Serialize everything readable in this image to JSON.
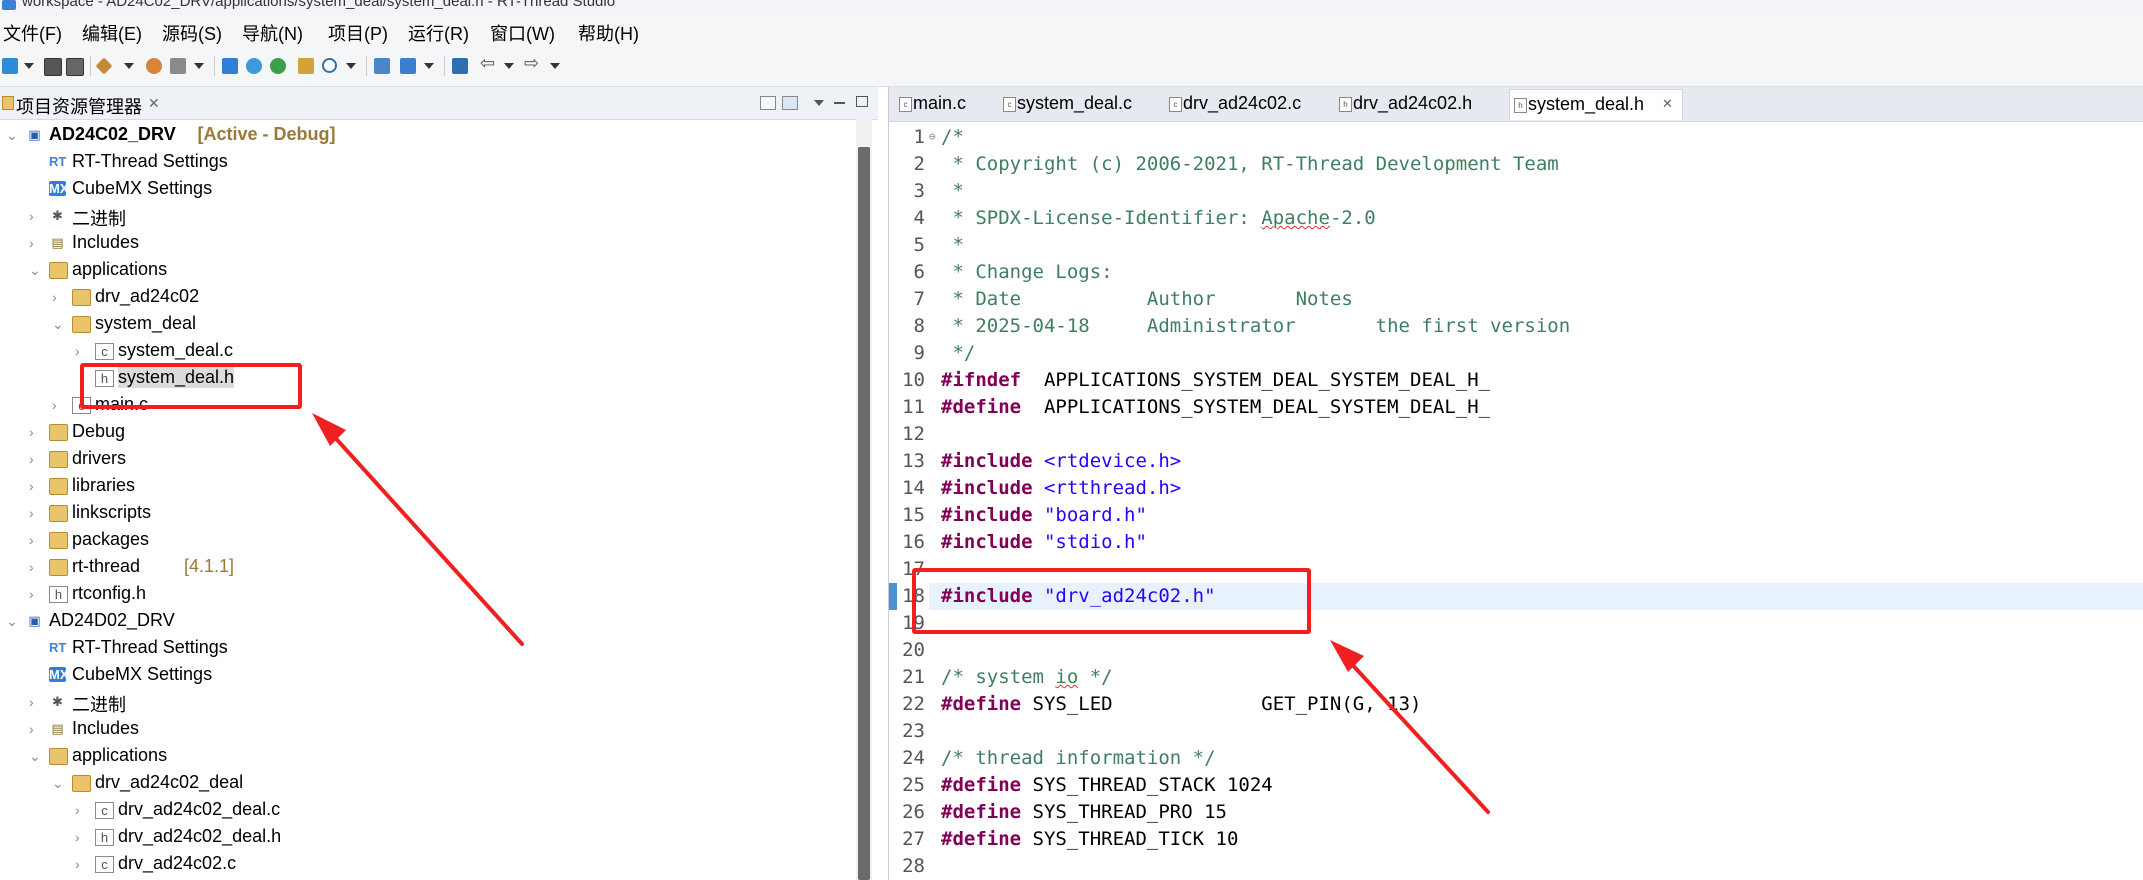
{
  "window": {
    "title": "workspace - AD24C02_DRV/applications/system_deal/system_deal.h - RT-Thread Studio"
  },
  "menu": [
    "文件(F)",
    "编辑(E)",
    "源码(S)",
    "导航(N)",
    "项目(P)",
    "运行(R)",
    "窗口(W)",
    "帮助(H)"
  ],
  "explorer": {
    "title": "项目资源管理器",
    "tree": [
      {
        "level": 0,
        "twisty": "open",
        "icon": "project",
        "label": "AD24C02_DRV",
        "suffix": "[Active - Debug]",
        "bold": true
      },
      {
        "level": 1,
        "twisty": "",
        "icon": "rt",
        "label": "RT-Thread Settings"
      },
      {
        "level": 1,
        "twisty": "",
        "icon": "mx",
        "label": "CubeMX Settings"
      },
      {
        "level": 1,
        "twisty": "closed",
        "icon": "binary",
        "label": "二进制"
      },
      {
        "level": 1,
        "twisty": "closed",
        "icon": "includes",
        "label": "Includes"
      },
      {
        "level": 1,
        "twisty": "open",
        "icon": "folder",
        "label": "applications"
      },
      {
        "level": 2,
        "twisty": "closed",
        "icon": "folder",
        "label": "drv_ad24c02"
      },
      {
        "level": 2,
        "twisty": "open",
        "icon": "folder",
        "label": "system_deal"
      },
      {
        "level": 3,
        "twisty": "closed",
        "icon": "c",
        "label": "system_deal.c"
      },
      {
        "level": 3,
        "twisty": "",
        "icon": "h",
        "label": "system_deal.h",
        "selected": true
      },
      {
        "level": 2,
        "twisty": "closed",
        "icon": "c",
        "label": "main.c"
      },
      {
        "level": 1,
        "twisty": "closed",
        "icon": "folder",
        "label": "Debug"
      },
      {
        "level": 1,
        "twisty": "closed",
        "icon": "folder",
        "label": "drivers"
      },
      {
        "level": 1,
        "twisty": "closed",
        "icon": "folder",
        "label": "libraries"
      },
      {
        "level": 1,
        "twisty": "closed",
        "icon": "folder",
        "label": "linkscripts"
      },
      {
        "level": 1,
        "twisty": "closed",
        "icon": "folder",
        "label": "packages"
      },
      {
        "level": 1,
        "twisty": "closed",
        "icon": "folder",
        "label": "rt-thread",
        "suffix": "[4.1.1]"
      },
      {
        "level": 1,
        "twisty": "closed",
        "icon": "h",
        "label": "rtconfig.h"
      },
      {
        "level": 0,
        "twisty": "open",
        "icon": "project",
        "label": "AD24D02_DRV"
      },
      {
        "level": 1,
        "twisty": "",
        "icon": "rt",
        "label": "RT-Thread Settings"
      },
      {
        "level": 1,
        "twisty": "",
        "icon": "mx",
        "label": "CubeMX Settings"
      },
      {
        "level": 1,
        "twisty": "closed",
        "icon": "binary",
        "label": "二进制"
      },
      {
        "level": 1,
        "twisty": "closed",
        "icon": "includes",
        "label": "Includes"
      },
      {
        "level": 1,
        "twisty": "open",
        "icon": "folder",
        "label": "applications"
      },
      {
        "level": 2,
        "twisty": "open",
        "icon": "folder",
        "label": "drv_ad24c02_deal"
      },
      {
        "level": 3,
        "twisty": "closed",
        "icon": "c",
        "label": "drv_ad24c02_deal.c"
      },
      {
        "level": 3,
        "twisty": "closed",
        "icon": "h",
        "label": "drv_ad24c02_deal.h"
      },
      {
        "level": 3,
        "twisty": "closed",
        "icon": "c",
        "label": "drv_ad24c02.c"
      }
    ]
  },
  "editor": {
    "tabs": [
      {
        "label": "main.c",
        "icon": "c"
      },
      {
        "label": "system_deal.c",
        "icon": "c"
      },
      {
        "label": "drv_ad24c02.c",
        "icon": "c"
      },
      {
        "label": "drv_ad24c02.h",
        "icon": "h"
      },
      {
        "label": "system_deal.h",
        "icon": "h",
        "active": true
      }
    ],
    "current_line": 18,
    "lines": [
      {
        "n": "1",
        "parts": [
          [
            "cm",
            "/*"
          ]
        ]
      },
      {
        "n": "2",
        "parts": [
          [
            "cm",
            " * Copyright (c) 2006-2021, RT-Thread Development Team"
          ]
        ]
      },
      {
        "n": "3",
        "parts": [
          [
            "cm",
            " *"
          ]
        ]
      },
      {
        "n": "4",
        "parts": [
          [
            "cm",
            " * SPDX-License-Identifier: "
          ],
          [
            "cm squig",
            "Apache"
          ],
          [
            "cm",
            "-2.0"
          ]
        ]
      },
      {
        "n": "5",
        "parts": [
          [
            "cm",
            " *"
          ]
        ]
      },
      {
        "n": "6",
        "parts": [
          [
            "cm",
            " * Change Logs:"
          ]
        ]
      },
      {
        "n": "7",
        "parts": [
          [
            "cm",
            " * Date           Author       Notes"
          ]
        ]
      },
      {
        "n": "8",
        "parts": [
          [
            "cm",
            " * 2025-04-18     Administrator       the first version"
          ]
        ]
      },
      {
        "n": "9",
        "parts": [
          [
            "cm",
            " */"
          ]
        ]
      },
      {
        "n": "10",
        "parts": [
          [
            "kw",
            "#ifndef"
          ],
          [
            "",
            "  APPLICATIONS_SYSTEM_DEAL_SYSTEM_DEAL_H_"
          ]
        ]
      },
      {
        "n": "11",
        "parts": [
          [
            "kw",
            "#define"
          ],
          [
            "",
            "  APPLICATIONS_SYSTEM_DEAL_SYSTEM_DEAL_H_"
          ]
        ]
      },
      {
        "n": "12",
        "parts": []
      },
      {
        "n": "13",
        "parts": [
          [
            "kw",
            "#include"
          ],
          [
            "",
            " "
          ],
          [
            "st",
            "<rtdevice.h>"
          ]
        ]
      },
      {
        "n": "14",
        "parts": [
          [
            "kw",
            "#include"
          ],
          [
            "",
            " "
          ],
          [
            "st",
            "<rtthread.h>"
          ]
        ]
      },
      {
        "n": "15",
        "parts": [
          [
            "kw",
            "#include"
          ],
          [
            "",
            " "
          ],
          [
            "st",
            "\"board.h\""
          ]
        ]
      },
      {
        "n": "16",
        "parts": [
          [
            "kw",
            "#include"
          ],
          [
            "",
            " "
          ],
          [
            "st",
            "\"stdio.h\""
          ]
        ]
      },
      {
        "n": "17",
        "parts": []
      },
      {
        "n": "18",
        "parts": [
          [
            "kw",
            "#include"
          ],
          [
            "",
            " "
          ],
          [
            "st",
            "\"drv_ad24c02.h\""
          ]
        ]
      },
      {
        "n": "19",
        "parts": []
      },
      {
        "n": "20",
        "parts": []
      },
      {
        "n": "21",
        "parts": [
          [
            "cm",
            "/* system "
          ],
          [
            "cm squig",
            "io"
          ],
          [
            "cm",
            " */"
          ]
        ]
      },
      {
        "n": "22",
        "parts": [
          [
            "kw",
            "#define"
          ],
          [
            "",
            " SYS_LED             GET_PIN(G, 13)"
          ]
        ]
      },
      {
        "n": "23",
        "parts": []
      },
      {
        "n": "24",
        "parts": [
          [
            "cm",
            "/* thread information */"
          ]
        ]
      },
      {
        "n": "25",
        "parts": [
          [
            "kw",
            "#define"
          ],
          [
            "",
            " SYS_THREAD_STACK 1024"
          ]
        ]
      },
      {
        "n": "26",
        "parts": [
          [
            "kw",
            "#define"
          ],
          [
            "",
            " SYS_THREAD_PRO 15"
          ]
        ]
      },
      {
        "n": "27",
        "parts": [
          [
            "kw",
            "#define"
          ],
          [
            "",
            " SYS_THREAD_TICK 10"
          ]
        ]
      },
      {
        "n": "28",
        "parts": []
      }
    ]
  },
  "colors": {
    "annotation_red": "#f02020",
    "comment": "#3f7f5f",
    "keyword": "#7f0055",
    "string": "#2a00ff"
  }
}
